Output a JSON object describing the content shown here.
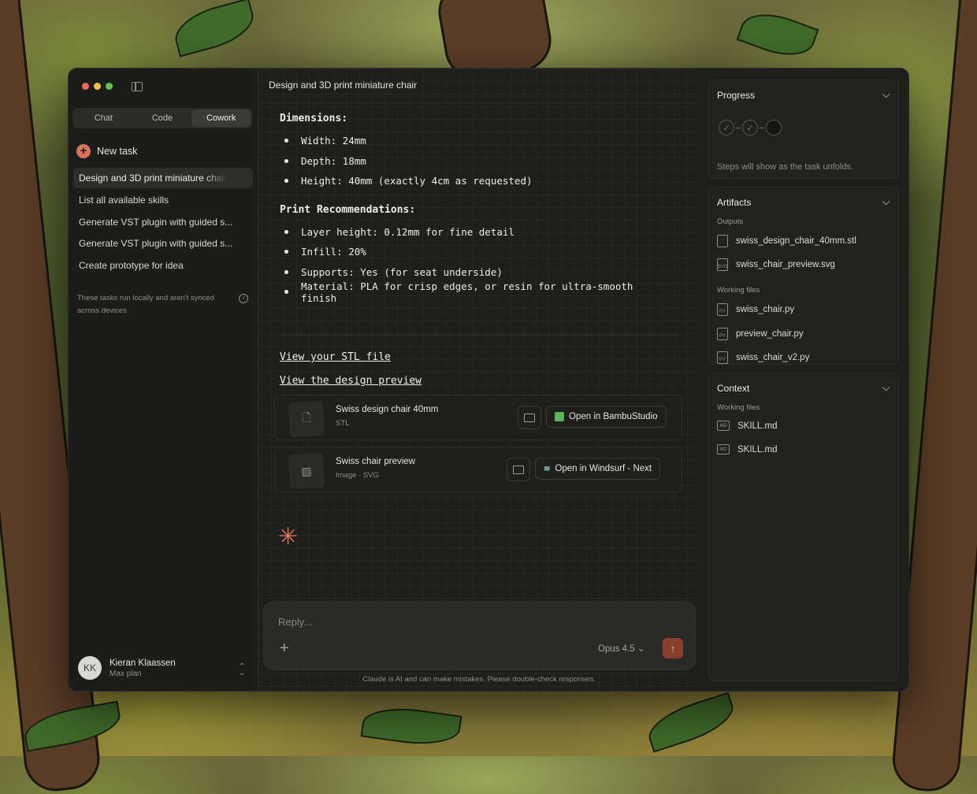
{
  "sidebar": {
    "modes": [
      "Chat",
      "Code",
      "Cowork"
    ],
    "active_mode": "Cowork",
    "new_task_label": "New task",
    "tasks": [
      "Design and 3D print miniature chair",
      "List all available skills",
      "Generate VST plugin with guided s...",
      "Generate VST plugin with guided s...",
      "Create prototype for idea"
    ],
    "local_note": "These tasks run locally and aren't synced across devices",
    "user": {
      "initials": "KK",
      "name": "Kieran Klaassen",
      "plan": "Max plan"
    }
  },
  "main": {
    "title": "Design and 3D print miniature chair",
    "dimensions_heading": "Dimensions:",
    "dimensions": [
      "Width: 24mm",
      "Depth: 18mm",
      "Height: 40mm (exactly 4cm as requested)"
    ],
    "print_heading": "Print Recommendations:",
    "print_recs": [
      "Layer height: 0.12mm for fine detail",
      "Infill: 20%",
      "Supports: Yes (for seat underside)",
      "Material: PLA for crisp edges, or resin for ultra-smooth finish"
    ],
    "links": [
      "View your STL file",
      "View the design preview"
    ],
    "files": [
      {
        "name": "Swiss design chair 40mm",
        "type": "STL",
        "open_label": "Open in BambuStudio"
      },
      {
        "name": "Swiss chair preview",
        "type": "Image · SVG",
        "open_label": "Open in Windsurf - Next"
      }
    ],
    "composer": {
      "placeholder": "Reply...",
      "model": "Opus 4.5"
    },
    "disclaimer": "Claude is AI and can make mistakes. Please double-check responses."
  },
  "right": {
    "progress": {
      "title": "Progress",
      "note": "Steps will show as the task unfolds."
    },
    "artifacts": {
      "title": "Artifacts",
      "outputs_label": "Outputs",
      "outputs": [
        "swiss_design_chair_40mm.stl",
        "swiss_chair_preview.svg"
      ],
      "working_label": "Working files",
      "working": [
        "swiss_chair.py",
        "preview_chair.py",
        "swiss_chair_v2.py"
      ]
    },
    "context": {
      "title": "Context",
      "working_label": "Working files",
      "files": [
        "SKILL.md",
        "SKILL.md"
      ]
    }
  },
  "colors": {
    "accent": "#d9735a",
    "send": "#8a3e2e",
    "bambu": "#5bb45b"
  }
}
